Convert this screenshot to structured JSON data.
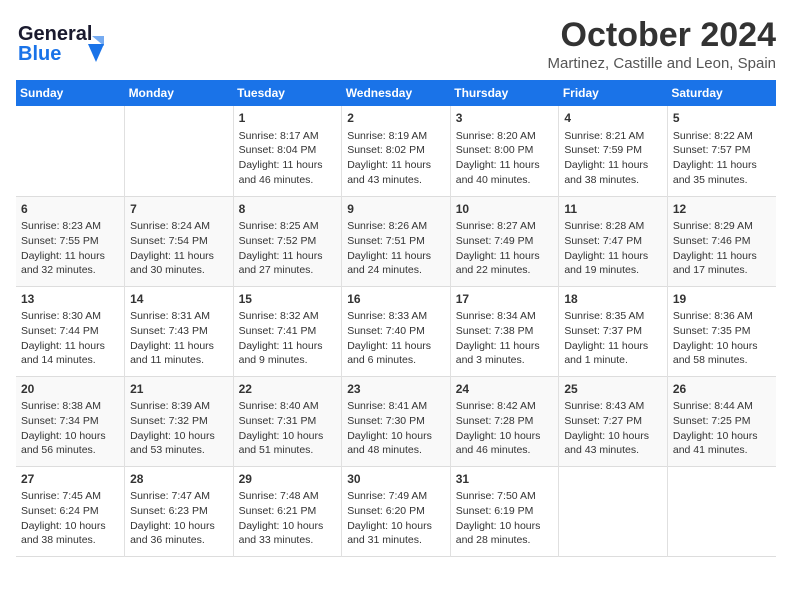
{
  "header": {
    "logo_line1": "General",
    "logo_line2": "Blue",
    "month": "October 2024",
    "location": "Martinez, Castille and Leon, Spain"
  },
  "days_of_week": [
    "Sunday",
    "Monday",
    "Tuesday",
    "Wednesday",
    "Thursday",
    "Friday",
    "Saturday"
  ],
  "weeks": [
    [
      {
        "day": "",
        "sunrise": "",
        "sunset": "",
        "daylight": ""
      },
      {
        "day": "",
        "sunrise": "",
        "sunset": "",
        "daylight": ""
      },
      {
        "day": "1",
        "sunrise": "Sunrise: 8:17 AM",
        "sunset": "Sunset: 8:04 PM",
        "daylight": "Daylight: 11 hours and 46 minutes."
      },
      {
        "day": "2",
        "sunrise": "Sunrise: 8:19 AM",
        "sunset": "Sunset: 8:02 PM",
        "daylight": "Daylight: 11 hours and 43 minutes."
      },
      {
        "day": "3",
        "sunrise": "Sunrise: 8:20 AM",
        "sunset": "Sunset: 8:00 PM",
        "daylight": "Daylight: 11 hours and 40 minutes."
      },
      {
        "day": "4",
        "sunrise": "Sunrise: 8:21 AM",
        "sunset": "Sunset: 7:59 PM",
        "daylight": "Daylight: 11 hours and 38 minutes."
      },
      {
        "day": "5",
        "sunrise": "Sunrise: 8:22 AM",
        "sunset": "Sunset: 7:57 PM",
        "daylight": "Daylight: 11 hours and 35 minutes."
      }
    ],
    [
      {
        "day": "6",
        "sunrise": "Sunrise: 8:23 AM",
        "sunset": "Sunset: 7:55 PM",
        "daylight": "Daylight: 11 hours and 32 minutes."
      },
      {
        "day": "7",
        "sunrise": "Sunrise: 8:24 AM",
        "sunset": "Sunset: 7:54 PM",
        "daylight": "Daylight: 11 hours and 30 minutes."
      },
      {
        "day": "8",
        "sunrise": "Sunrise: 8:25 AM",
        "sunset": "Sunset: 7:52 PM",
        "daylight": "Daylight: 11 hours and 27 minutes."
      },
      {
        "day": "9",
        "sunrise": "Sunrise: 8:26 AM",
        "sunset": "Sunset: 7:51 PM",
        "daylight": "Daylight: 11 hours and 24 minutes."
      },
      {
        "day": "10",
        "sunrise": "Sunrise: 8:27 AM",
        "sunset": "Sunset: 7:49 PM",
        "daylight": "Daylight: 11 hours and 22 minutes."
      },
      {
        "day": "11",
        "sunrise": "Sunrise: 8:28 AM",
        "sunset": "Sunset: 7:47 PM",
        "daylight": "Daylight: 11 hours and 19 minutes."
      },
      {
        "day": "12",
        "sunrise": "Sunrise: 8:29 AM",
        "sunset": "Sunset: 7:46 PM",
        "daylight": "Daylight: 11 hours and 17 minutes."
      }
    ],
    [
      {
        "day": "13",
        "sunrise": "Sunrise: 8:30 AM",
        "sunset": "Sunset: 7:44 PM",
        "daylight": "Daylight: 11 hours and 14 minutes."
      },
      {
        "day": "14",
        "sunrise": "Sunrise: 8:31 AM",
        "sunset": "Sunset: 7:43 PM",
        "daylight": "Daylight: 11 hours and 11 minutes."
      },
      {
        "day": "15",
        "sunrise": "Sunrise: 8:32 AM",
        "sunset": "Sunset: 7:41 PM",
        "daylight": "Daylight: 11 hours and 9 minutes."
      },
      {
        "day": "16",
        "sunrise": "Sunrise: 8:33 AM",
        "sunset": "Sunset: 7:40 PM",
        "daylight": "Daylight: 11 hours and 6 minutes."
      },
      {
        "day": "17",
        "sunrise": "Sunrise: 8:34 AM",
        "sunset": "Sunset: 7:38 PM",
        "daylight": "Daylight: 11 hours and 3 minutes."
      },
      {
        "day": "18",
        "sunrise": "Sunrise: 8:35 AM",
        "sunset": "Sunset: 7:37 PM",
        "daylight": "Daylight: 11 hours and 1 minute."
      },
      {
        "day": "19",
        "sunrise": "Sunrise: 8:36 AM",
        "sunset": "Sunset: 7:35 PM",
        "daylight": "Daylight: 10 hours and 58 minutes."
      }
    ],
    [
      {
        "day": "20",
        "sunrise": "Sunrise: 8:38 AM",
        "sunset": "Sunset: 7:34 PM",
        "daylight": "Daylight: 10 hours and 56 minutes."
      },
      {
        "day": "21",
        "sunrise": "Sunrise: 8:39 AM",
        "sunset": "Sunset: 7:32 PM",
        "daylight": "Daylight: 10 hours and 53 minutes."
      },
      {
        "day": "22",
        "sunrise": "Sunrise: 8:40 AM",
        "sunset": "Sunset: 7:31 PM",
        "daylight": "Daylight: 10 hours and 51 minutes."
      },
      {
        "day": "23",
        "sunrise": "Sunrise: 8:41 AM",
        "sunset": "Sunset: 7:30 PM",
        "daylight": "Daylight: 10 hours and 48 minutes."
      },
      {
        "day": "24",
        "sunrise": "Sunrise: 8:42 AM",
        "sunset": "Sunset: 7:28 PM",
        "daylight": "Daylight: 10 hours and 46 minutes."
      },
      {
        "day": "25",
        "sunrise": "Sunrise: 8:43 AM",
        "sunset": "Sunset: 7:27 PM",
        "daylight": "Daylight: 10 hours and 43 minutes."
      },
      {
        "day": "26",
        "sunrise": "Sunrise: 8:44 AM",
        "sunset": "Sunset: 7:25 PM",
        "daylight": "Daylight: 10 hours and 41 minutes."
      }
    ],
    [
      {
        "day": "27",
        "sunrise": "Sunrise: 7:45 AM",
        "sunset": "Sunset: 6:24 PM",
        "daylight": "Daylight: 10 hours and 38 minutes."
      },
      {
        "day": "28",
        "sunrise": "Sunrise: 7:47 AM",
        "sunset": "Sunset: 6:23 PM",
        "daylight": "Daylight: 10 hours and 36 minutes."
      },
      {
        "day": "29",
        "sunrise": "Sunrise: 7:48 AM",
        "sunset": "Sunset: 6:21 PM",
        "daylight": "Daylight: 10 hours and 33 minutes."
      },
      {
        "day": "30",
        "sunrise": "Sunrise: 7:49 AM",
        "sunset": "Sunset: 6:20 PM",
        "daylight": "Daylight: 10 hours and 31 minutes."
      },
      {
        "day": "31",
        "sunrise": "Sunrise: 7:50 AM",
        "sunset": "Sunset: 6:19 PM",
        "daylight": "Daylight: 10 hours and 28 minutes."
      },
      {
        "day": "",
        "sunrise": "",
        "sunset": "",
        "daylight": ""
      },
      {
        "day": "",
        "sunrise": "",
        "sunset": "",
        "daylight": ""
      }
    ]
  ]
}
